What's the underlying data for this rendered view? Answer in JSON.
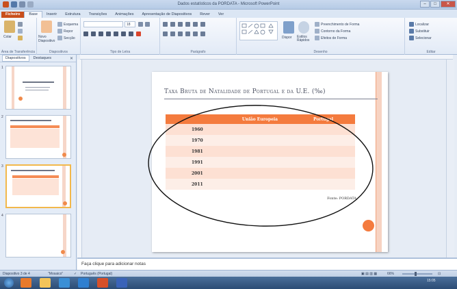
{
  "window": {
    "title": "Dados estatísticos da PORDATA - Microsoft PowerPoint",
    "minimize": "–",
    "maximize": "□",
    "close": "✕"
  },
  "ribbon_tabs": [
    "Ficheiro",
    "Base",
    "Inserir",
    "Estrutura",
    "Transições",
    "Animações",
    "Apresentação de Diapositivos",
    "Rever",
    "Ver"
  ],
  "ribbon": {
    "clipboard": {
      "paste": "Colar",
      "group": "Área de Transferência"
    },
    "slides": {
      "new_slide": "Novo Diapositivo",
      "layout": "Esquema",
      "reset": "Repor",
      "section": "Secção",
      "group": "Diapositivos"
    },
    "font": {
      "size": "18",
      "group": "Tipo de Letra"
    },
    "paragraph": {
      "group": "Parágrafo"
    },
    "drawing": {
      "arrange": "Dispor",
      "quick_styles": "Estilos Rápidos",
      "shape_fill": "Preenchimento de Forma",
      "shape_outline": "Contorno da Forma",
      "shape_effects": "Efeitos de Forma",
      "group": "Desenho"
    },
    "editing": {
      "find": "Localizar",
      "replace": "Substituir",
      "select": "Selecionar",
      "group": "Editar"
    }
  },
  "left_pane": {
    "tab_slides": "Diapositivos",
    "tab_outline": "Destaques",
    "close": "✕",
    "thumbnails": [
      {
        "number": "1"
      },
      {
        "number": "2"
      },
      {
        "number": "3"
      },
      {
        "number": "4"
      }
    ]
  },
  "slide": {
    "title": "Taxa Bruta de Natalidade de Portugal e da U.E. (‰)",
    "table": {
      "headers": [
        "",
        "União Europeia",
        "Portugal"
      ],
      "rows": [
        [
          "1960",
          "",
          ""
        ],
        [
          "1970",
          "",
          ""
        ],
        [
          "1981",
          "",
          ""
        ],
        [
          "1991",
          "",
          ""
        ],
        [
          "2001",
          "",
          ""
        ],
        [
          "2011",
          "",
          ""
        ]
      ]
    },
    "source": "Fonte: PORDATA"
  },
  "notes": {
    "placeholder": "Faça clique para adicionar notas"
  },
  "status": {
    "slide_counter": "Diapositivo 3 de 4",
    "theme": "\"Mosaico\"",
    "language": "Português (Portugal)",
    "zoom": "66%"
  },
  "taskbar": {
    "time": "15:05"
  },
  "colors": {
    "accent_orange": "#f47b3e",
    "file_tab": "#c94f1c",
    "row_light": "#fde0d3"
  }
}
